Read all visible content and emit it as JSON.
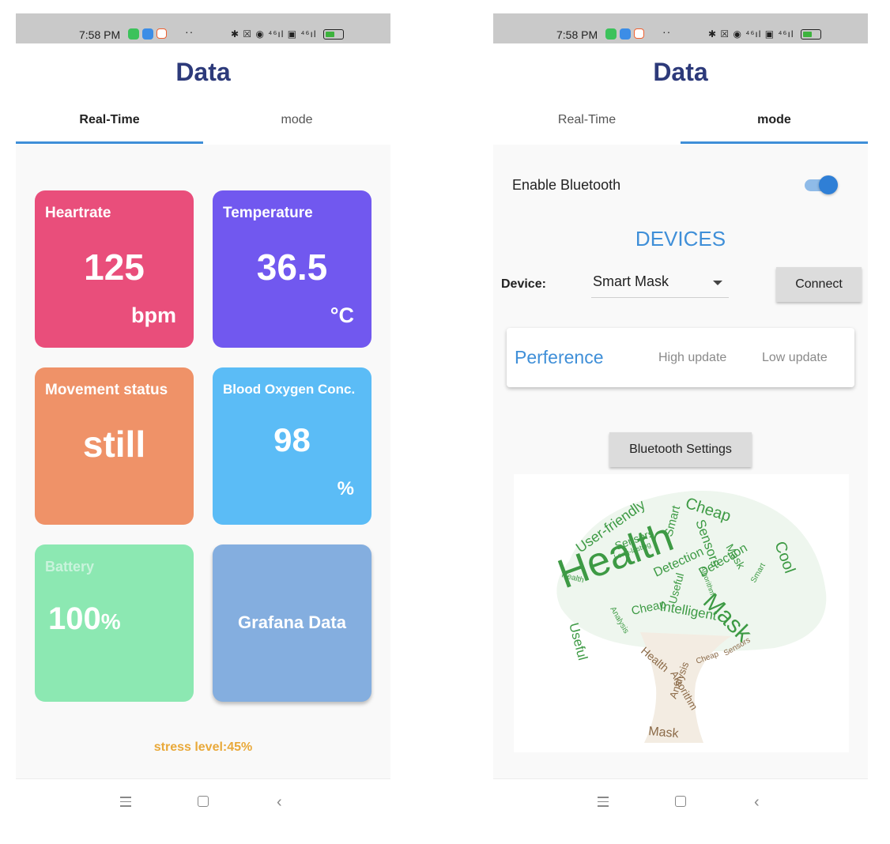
{
  "status_bar": {
    "time": "7:58 PM",
    "more": "··",
    "signal": "✱ ☒ ◉ ⁴⁶ıl ▣ ⁴⁶ıl",
    "battery_level": 0.6
  },
  "left_screen": {
    "title": "Data",
    "tabs": [
      {
        "label": "Real-Time",
        "active": true
      },
      {
        "label": "mode",
        "active": false
      }
    ],
    "cards": [
      {
        "title": "Heartrate",
        "value": "125",
        "unit": "bpm",
        "color": "#e94e7b"
      },
      {
        "title": "Temperature",
        "value": "36.5",
        "unit": "°C",
        "color": "#7158ef"
      },
      {
        "title": "Movement status",
        "value": "still",
        "unit": "",
        "color": "#ef9268"
      },
      {
        "title": "Blood Oxygen Conc.",
        "value": "98",
        "unit": "%",
        "color": "#5bbcf6"
      },
      {
        "title": "Battery",
        "value": "100",
        "unit": "%",
        "color": "#8ce8b2"
      },
      {
        "title": "",
        "value": "Grafana Data",
        "unit": "",
        "color": "#84aedf"
      }
    ],
    "stress_text": "stress level:45%"
  },
  "right_screen": {
    "title": "Data",
    "tabs": [
      {
        "label": "Real-Time",
        "active": false
      },
      {
        "label": "mode",
        "active": true
      }
    ],
    "bluetooth_label": "Enable Bluetooth",
    "bluetooth_enabled": true,
    "devices_heading": "DEVICES",
    "device_label": "Device:",
    "device_value": "Smart Mask",
    "connect_label": "Connect",
    "preference_label": "Perference",
    "preference_options": [
      "High update",
      "Low update"
    ],
    "bt_settings_label": "Bluetooth Settings",
    "word_cloud": {
      "words": [
        "Health",
        "Mask",
        "Sensors",
        "Cheap",
        "User-friendly",
        "Smart",
        "Cool",
        "Detection",
        "Intelligent",
        "Useful",
        "Analysis",
        "Algorithm",
        "Long-lasting",
        "Sensors",
        "Cheap",
        "Health",
        "Useful",
        "Smart",
        "Mask",
        "Detection",
        "Analysis",
        "Algorithm",
        "Mask",
        "Health",
        "Cheap",
        "Sensors"
      ],
      "accent_colors": {
        "leaves": "#3d9a44",
        "trunk": "#8b6a48"
      }
    }
  },
  "nav": {
    "back_glyph": "‹"
  }
}
